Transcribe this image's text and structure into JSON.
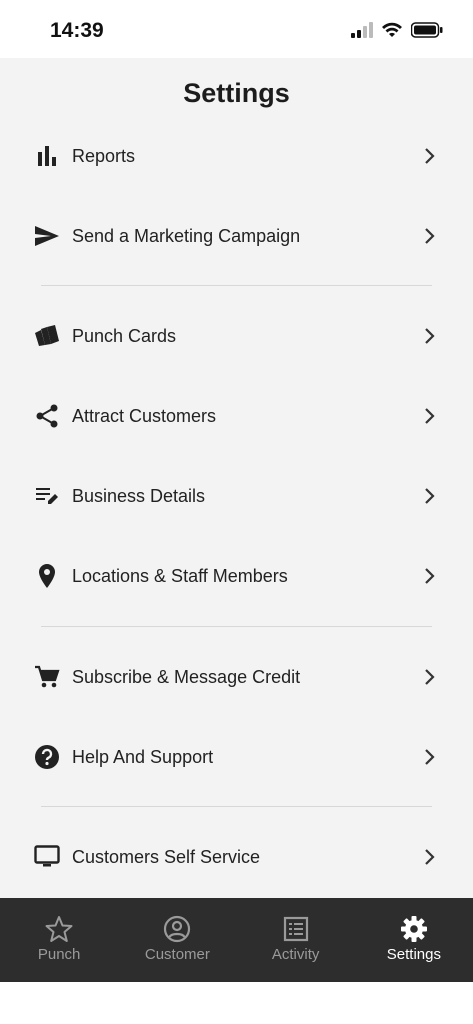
{
  "status_bar": {
    "time": "14:39",
    "icons": [
      "cellular-signal-icon",
      "wifi-icon",
      "battery-icon"
    ]
  },
  "page": {
    "title": "Settings"
  },
  "menu_groups": [
    {
      "items": [
        {
          "label": "Reports",
          "icon": "bar-chart-icon"
        },
        {
          "label": "Send a Marketing Campaign",
          "icon": "send-icon"
        }
      ]
    },
    {
      "items": [
        {
          "label": "Punch Cards",
          "icon": "cards-icon"
        },
        {
          "label": "Attract Customers",
          "icon": "share-icon"
        },
        {
          "label": "Business Details",
          "icon": "edit-list-icon"
        },
        {
          "label": "Locations & Staff Members",
          "icon": "location-pin-icon"
        }
      ]
    },
    {
      "items": [
        {
          "label": "Subscribe & Message Credit",
          "icon": "shopping-cart-icon"
        },
        {
          "label": "Help And Support",
          "icon": "help-icon"
        }
      ]
    },
    {
      "items": [
        {
          "label": "Customers Self Service",
          "icon": "monitor-icon"
        }
      ]
    }
  ],
  "tabbar": {
    "active": "Settings",
    "tabs": [
      {
        "label": "Punch",
        "icon": "star-icon"
      },
      {
        "label": "Customer",
        "icon": "account-circle-icon"
      },
      {
        "label": "Activity",
        "icon": "list-icon"
      },
      {
        "label": "Settings",
        "icon": "gear-icon"
      }
    ]
  },
  "colors": {
    "background": "#f3f3f3",
    "tabbar": "#2d2d2d",
    "tab_inactive": "#9a9a9a",
    "tab_active": "#ffffff",
    "text": "#1f1f1f"
  }
}
